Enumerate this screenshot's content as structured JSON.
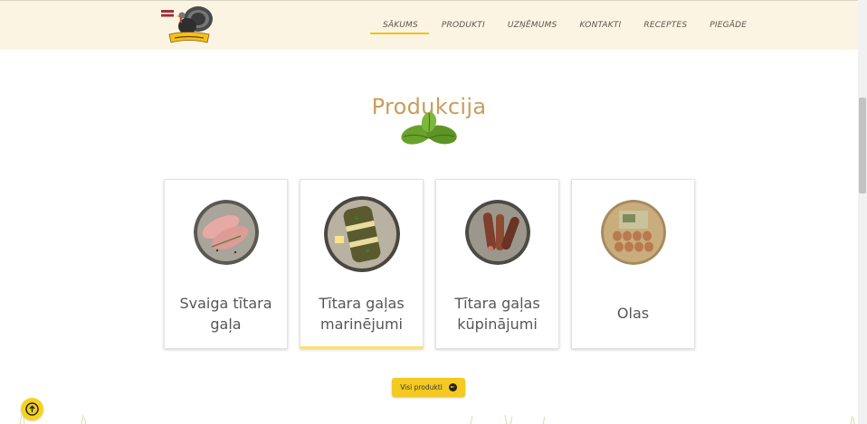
{
  "header": {
    "logo_name": "turkey-flag-logo",
    "nav": [
      {
        "label": "SĀKUMS",
        "active": true
      },
      {
        "label": "PRODUKTI",
        "active": false
      },
      {
        "label": "UZŅĒMUMS",
        "active": false
      },
      {
        "label": "KONTAKTI",
        "active": false
      },
      {
        "label": "RECEPTES",
        "active": false
      },
      {
        "label": "PIEGĀDE",
        "active": false
      }
    ]
  },
  "main": {
    "title": "Produkcija",
    "products": [
      {
        "line1": "Svaiga tītara",
        "line2": "gaļa"
      },
      {
        "line1": "Tītara gaļas",
        "line2": "marinējumi"
      },
      {
        "line1": "Tītara gaļas",
        "line2": "kūpinājumi"
      },
      {
        "line1": "Olas",
        "line2": ""
      }
    ],
    "all_products_label": "Visi produkti"
  },
  "colors": {
    "header_bg": "#fbf4e3",
    "accent_yellow": "#f4c920",
    "title_tan": "#c89d5c"
  }
}
